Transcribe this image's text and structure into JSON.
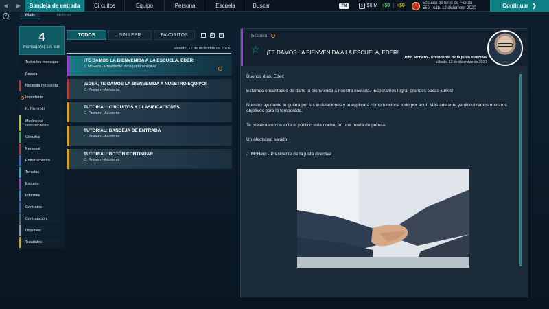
{
  "nav": {
    "tabs": [
      "Bandeja de entrada",
      "Circuitos",
      "Equipo",
      "Personal",
      "Escuela",
      "Buscar"
    ],
    "active_tab": "Bandeja de entrada"
  },
  "status": {
    "logo": "TM",
    "money": "$6 M",
    "delta_green": "+$0",
    "delta_yellow": "+$0",
    "school_name": "Escuela de tenis de Florida",
    "school_date": "550 - sáb. 12 diciembre 2020",
    "continue_label": "Continuar"
  },
  "subnav": {
    "tabs": [
      "Mails",
      "Noticias"
    ]
  },
  "sidebar": {
    "unread_count": "4",
    "unread_label": "mensaje(s) sin leer",
    "items": [
      {
        "label": "Todos los mensajes",
        "color": ""
      },
      {
        "label": "Basura",
        "color": ""
      },
      {
        "label": "Necesita respuesta",
        "color": "#c8322c"
      },
      {
        "label": "Importante",
        "color": ""
      },
      {
        "label": "K. Nishiroki",
        "color": ""
      },
      {
        "label": "Medios de comunicación",
        "color": "#b8c93a"
      },
      {
        "label": "Circuitos",
        "color": "#4caf50"
      },
      {
        "label": "Personal",
        "color": "#b33a3a"
      },
      {
        "label": "Entrenamiento",
        "color": "#3b6bd6"
      },
      {
        "label": "Tenistas",
        "color": "#22b7c9"
      },
      {
        "label": "Escuela",
        "color": "#9b3fd0"
      },
      {
        "label": "Informes",
        "color": "#3d86c6"
      },
      {
        "label": "Contratos",
        "color": "#3c5fa8"
      },
      {
        "label": "Contratación",
        "color": "#4e6b7d"
      },
      {
        "label": "Objetivos",
        "color": "#8a9ba8"
      },
      {
        "label": "Tutoriales",
        "color": "#e0a21c"
      }
    ]
  },
  "list": {
    "tabs": [
      "TODOS",
      "SIN LEER",
      "FAVORITOS"
    ],
    "date": "sábado, 12 de diciembre de 2020",
    "mails": [
      {
        "title": "¡TE DAMOS LA BIENVENIDA A LA ESCUELA, EDER!",
        "sender": "J. McHero - Presidente de la junta directiva",
        "color": "#9b3fd0"
      },
      {
        "title": "¡EDER, TE DAMOS LA BIENVENIDA A NUESTRO EQUIPO!",
        "sender": "C. Powers - Asistente",
        "color": "#b33a3a"
      },
      {
        "title": "TUTORIAL: CIRCUITOS Y CLASIFICACIONES",
        "sender": "C. Powers - Asistente",
        "color": "#e0a21c"
      },
      {
        "title": "TUTORIAL: BANDEJA DE ENTRADA",
        "sender": "C. Powers - Asistente",
        "color": "#e0a21c"
      },
      {
        "title": "TUTORIAL: BOTÓN CONTINUAR",
        "sender": "C. Powers - Asistente",
        "color": "#e0a21c"
      }
    ]
  },
  "message": {
    "category": "Escuela",
    "subject": "¡TE DAMOS LA BIENVENIDA A LA ESCUELA, EDER!",
    "sender": "John McHero - Presidente de la junta directiva",
    "date": "sábado, 12 de diciembre de 2020",
    "paragraphs": [
      "Buenos días, Eder:",
      "Estamos encantados de darte la bienvenida a nuestra escuela. ¡Esperamos lograr grandes cosas juntos!",
      "Nuestro ayudante te guiará por las instalaciones y te explicará cómo funciona todo por aquí. Más adelante ya discutiremos nuestros objetivos para la temporada.",
      "Te presentaremos ante el público esta noche, en una rueda de prensa.",
      "Un afectuoso saludo,",
      "J. McHero - Presidente de la junta directiva"
    ]
  },
  "colors": {
    "accent": "#0f7f86",
    "purple": "#9b3fd0"
  }
}
